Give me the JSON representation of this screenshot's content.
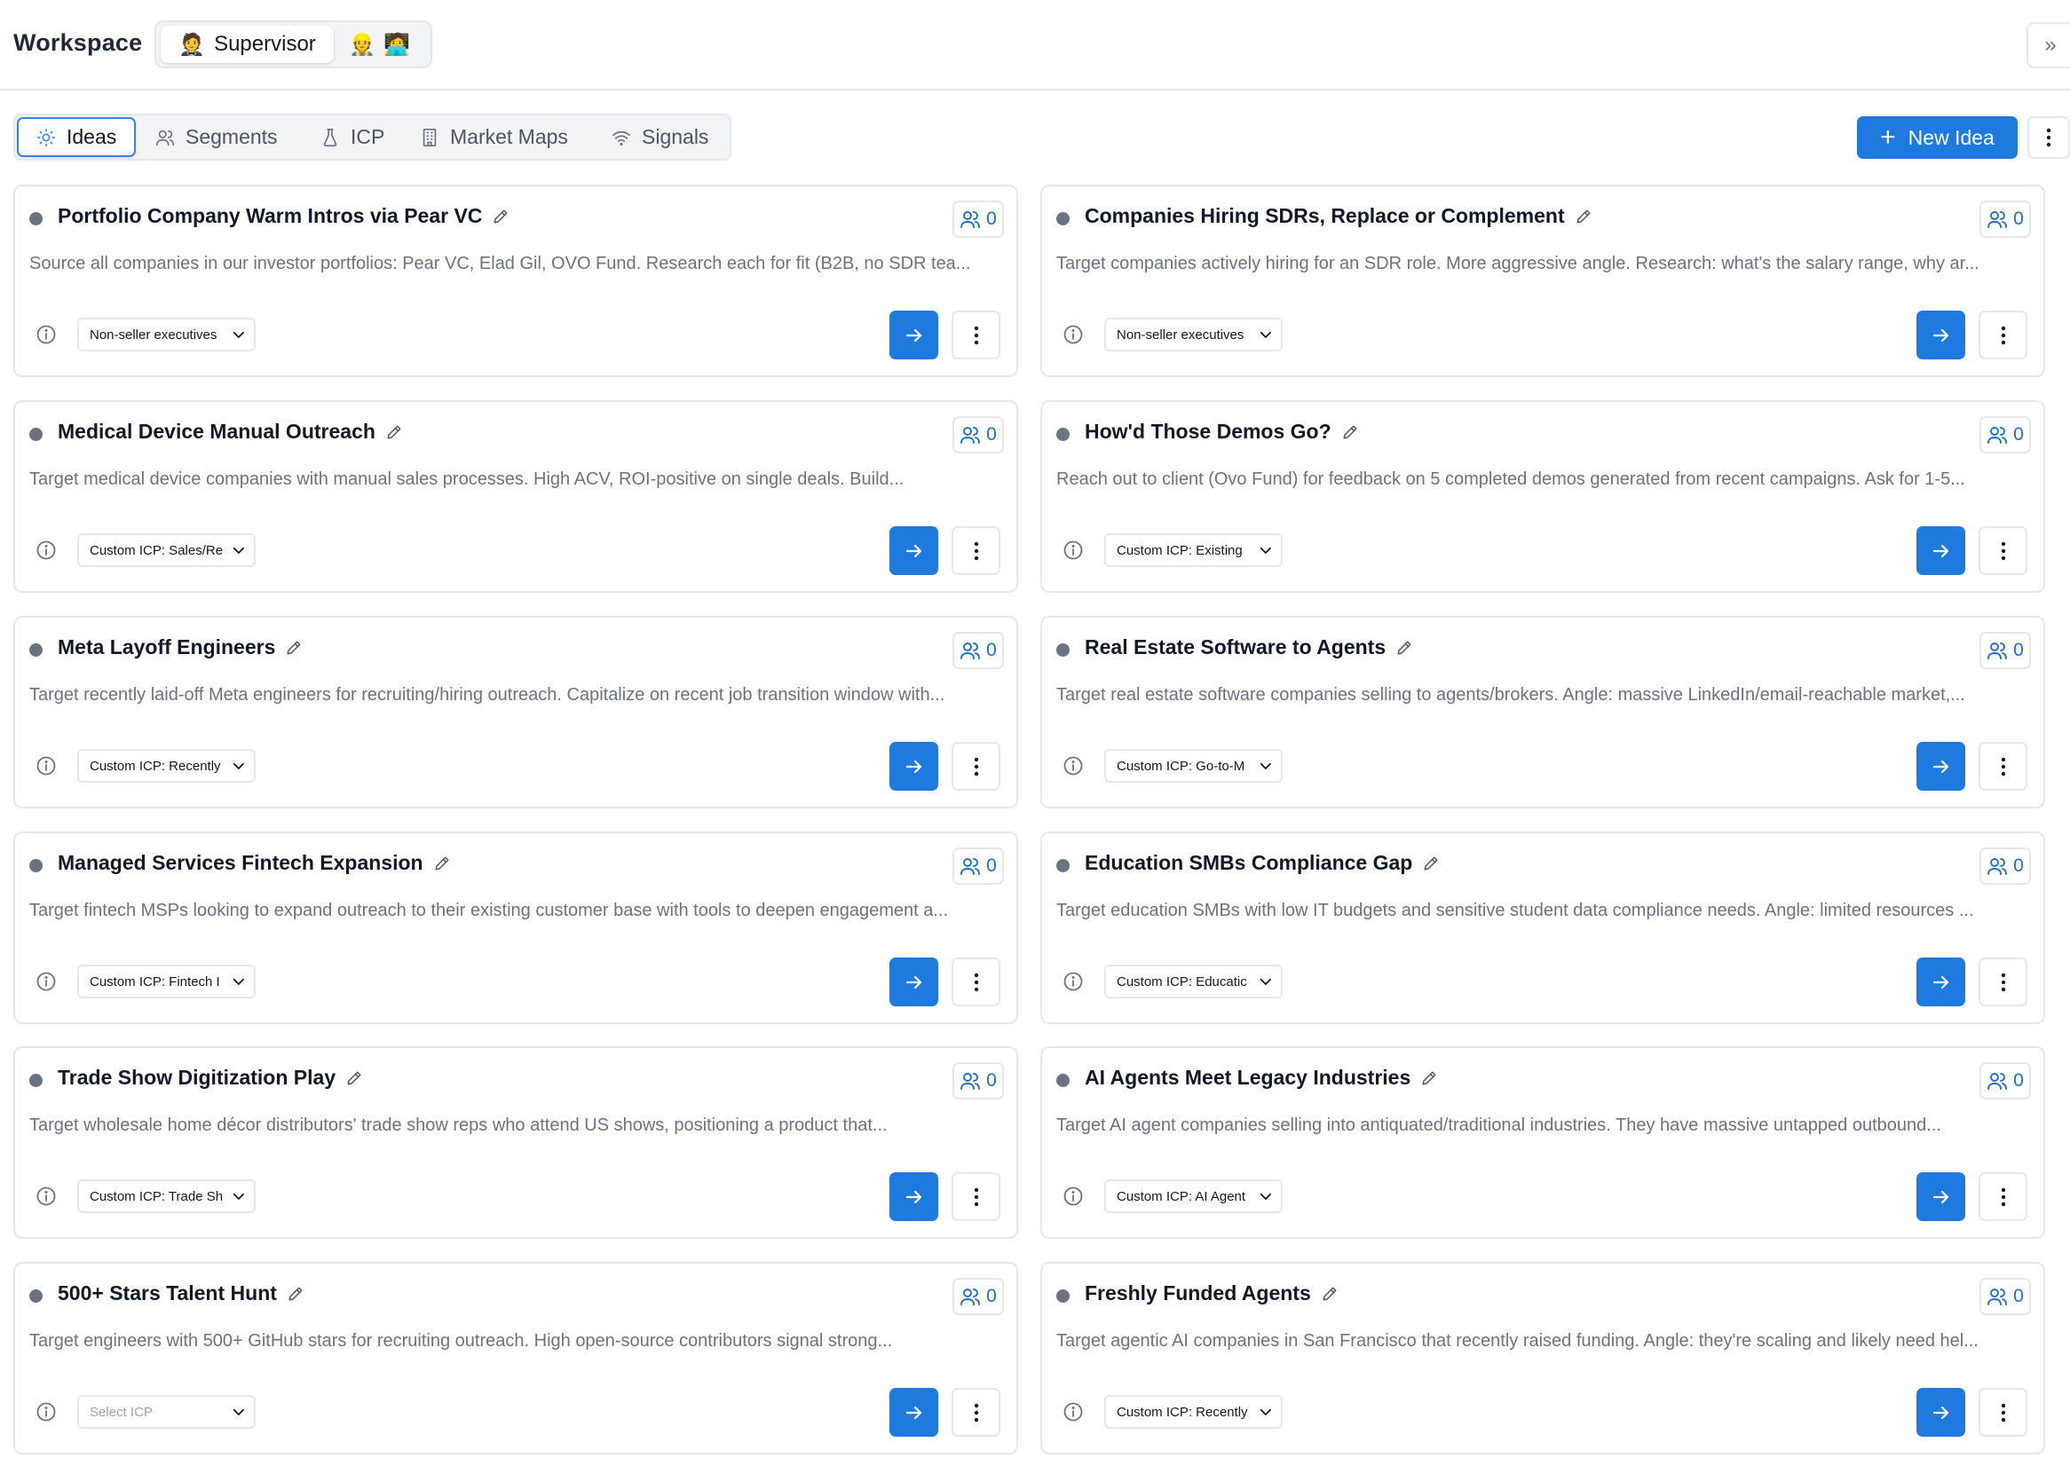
{
  "header": {
    "title": "Workspace",
    "roles": [
      {
        "label": "Supervisor",
        "icon": "🤵",
        "active": true
      },
      {
        "label": "",
        "icon": "👷",
        "active": false
      },
      {
        "label": "",
        "icon": "🧑‍💻",
        "active": false
      }
    ],
    "collapse_icon": "»"
  },
  "tabs": [
    {
      "label": "Ideas",
      "icon": "lightbulb-icon",
      "active": true
    },
    {
      "label": "Segments",
      "icon": "users-icon",
      "active": false
    },
    {
      "label": "ICP",
      "icon": "flask-icon",
      "active": false
    },
    {
      "label": "Market Maps",
      "icon": "building-icon",
      "active": false
    },
    {
      "label": "Signals",
      "icon": "wifi-icon",
      "active": false
    }
  ],
  "actions": {
    "new_idea_label": "New Idea"
  },
  "colors": {
    "accent": "#1f7ae0",
    "border": "#e5e7eb",
    "muted_text": "#6b7280",
    "status_dot": "#6b7280"
  },
  "ideas": [
    {
      "title": "Portfolio Company Warm Intros via Pear VC",
      "count": "0",
      "description": "Source all companies in our investor portfolios: Pear VC, Elad Gil, OVO Fund. Research each for fit (B2B, no SDR tea...",
      "icp": "Non-seller executives"
    },
    {
      "title": "Companies Hiring SDRs, Replace or Complement",
      "count": "0",
      "description": "Target companies actively hiring for an SDR role. More aggressive angle. Research: what's the salary range, why ar...",
      "icp": "Non-seller executives"
    },
    {
      "title": "Medical Device Manual Outreach",
      "count": "0",
      "description": "Target medical device companies with manual sales processes. High ACV, ROI-positive on single deals. Build...",
      "icp": "Custom ICP: Sales/Re"
    },
    {
      "title": "How'd Those Demos Go?",
      "count": "0",
      "description": "Reach out to client (Ovo Fund) for feedback on 5 completed demos generated from recent campaigns. Ask for 1-5...",
      "icp": "Custom ICP: Existing"
    },
    {
      "title": "Meta Layoff Engineers",
      "count": "0",
      "description": "Target recently laid-off Meta engineers for recruiting/hiring outreach. Capitalize on recent job transition window with...",
      "icp": "Custom ICP: Recently"
    },
    {
      "title": "Real Estate Software to Agents",
      "count": "0",
      "description": "Target real estate software companies selling to agents/brokers. Angle: massive LinkedIn/email-reachable market,...",
      "icp": "Custom ICP: Go-to-M"
    },
    {
      "title": "Managed Services Fintech Expansion",
      "count": "0",
      "description": "Target fintech MSPs looking to expand outreach to their existing customer base with tools to deepen engagement a...",
      "icp": "Custom ICP: Fintech I"
    },
    {
      "title": "Education SMBs Compliance Gap",
      "count": "0",
      "description": "Target education SMBs with low IT budgets and sensitive student data compliance needs. Angle: limited resources ...",
      "icp": "Custom ICP: Educatic"
    },
    {
      "title": "Trade Show Digitization Play",
      "count": "0",
      "description": "Target wholesale home décor distributors' trade show reps who attend US shows, positioning a product that...",
      "icp": "Custom ICP: Trade Sh"
    },
    {
      "title": "AI Agents Meet Legacy Industries",
      "count": "0",
      "description": "Target AI agent companies selling into antiquated/traditional industries. They have massive untapped outbound...",
      "icp": "Custom ICP: AI Agent"
    },
    {
      "title": "500+ Stars Talent Hunt",
      "count": "0",
      "description": "Target engineers with 500+ GitHub stars for recruiting outreach. High open-source contributors signal strong...",
      "icp": "",
      "icp_placeholder": "Select ICP"
    },
    {
      "title": "Freshly Funded Agents",
      "count": "0",
      "description": "Target agentic AI companies in San Francisco that recently raised funding. Angle: they're scaling and likely need hel...",
      "icp": "Custom ICP: Recently"
    }
  ]
}
